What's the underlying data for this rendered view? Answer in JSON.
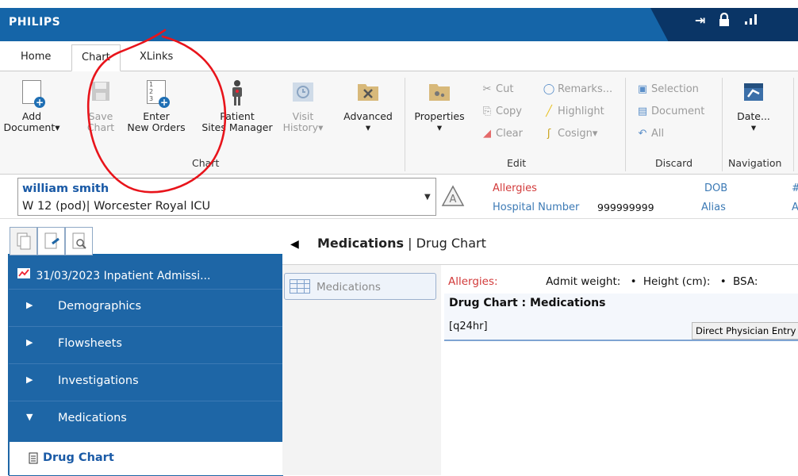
{
  "app": {
    "brand": "PHILIPS"
  },
  "titlebar": {
    "ctrl_pin": "⇥",
    "ctrl_lock": "🔒",
    "ctrl_signal": "▂▄▆"
  },
  "tabs": [
    {
      "label": "Home"
    },
    {
      "label": "Chart"
    },
    {
      "label": "XLinks"
    }
  ],
  "ribbon": {
    "chart": [
      {
        "line1": "Add",
        "line2": "Document▾"
      },
      {
        "line1": "Save",
        "line2": "Chart"
      },
      {
        "line1": "Enter",
        "line2": "New Orders"
      },
      {
        "line1": "Patient",
        "line2": "Sites Manager"
      },
      {
        "line1": "Visit",
        "line2": "History▾"
      },
      {
        "line1": "Advanced",
        "line2": "▾"
      }
    ],
    "chart_group": "Chart",
    "properties": {
      "line1": "Properties",
      "line2": "▾"
    },
    "edit": {
      "cut": "Cut",
      "copy": "Copy",
      "clear": "Clear",
      "remarks": "Remarks...",
      "highlight": "Highlight",
      "cosign": "Cosign▾",
      "group": "Edit"
    },
    "discard": {
      "selection": "Selection",
      "document": "Document",
      "all": "All",
      "group": "Discard"
    },
    "navigation": {
      "date": "Date...",
      "arrow": "▾",
      "group": "Navigation"
    }
  },
  "patient": {
    "name": "william smith",
    "location": "W 12 (pod)| Worcester Royal ICU",
    "allergies_label": "Allergies",
    "hospital_number_label": "Hospital Number",
    "hospital_number": "999999999",
    "dob_label": "DOB",
    "alias_label": "Alias",
    "hash": "#",
    "a_cut": "A"
  },
  "leftnav": {
    "header": "31/03/2023 Inpatient Admissi...",
    "items": [
      {
        "label": "Demographics",
        "chev": "▶"
      },
      {
        "label": "Flowsheets",
        "chev": "▶"
      },
      {
        "label": "Investigations",
        "chev": "▶"
      },
      {
        "label": "Medications",
        "chev": "▼"
      }
    ],
    "sub": "Drug Chart"
  },
  "main": {
    "title_bold": "Medications",
    "title_rest": "| Drug Chart",
    "side_button": "Medications",
    "allergies": "Allergies:",
    "admit_weight": "Admit weight:",
    "height": "Height (cm):",
    "bsa": "BSA:",
    "chart_title": "Drug Chart : Medications",
    "freq": "[q24hr]",
    "dpe": "Direct Physician Entry"
  },
  "colors": {
    "brand_blue": "#1565a8",
    "nav_blue": "#1e66a6",
    "annotation": "#e8141b"
  }
}
